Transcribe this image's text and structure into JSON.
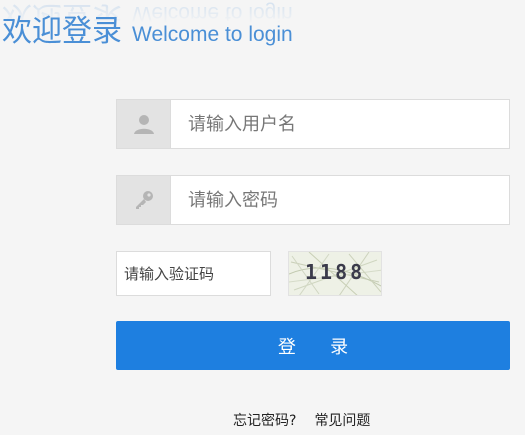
{
  "header": {
    "title_cn": "欢迎登录",
    "title_en": "Welcome to login"
  },
  "login_form": {
    "username": {
      "value": "",
      "placeholder": "请输入用户名",
      "icon": "user-icon"
    },
    "password": {
      "value": "",
      "placeholder": "请输入密码",
      "icon": "key-icon"
    },
    "captcha": {
      "value": "",
      "placeholder": "请输入验证码",
      "image_text": "1188"
    },
    "submit_label": "登      录"
  },
  "links": {
    "forgot_password": "忘记密码?",
    "faq": "常见问题"
  },
  "colors": {
    "accent": "#1e7fe0",
    "title": "#4a8fd6",
    "background": "#f5f5f5",
    "icon_box": "#e3e3e3"
  }
}
